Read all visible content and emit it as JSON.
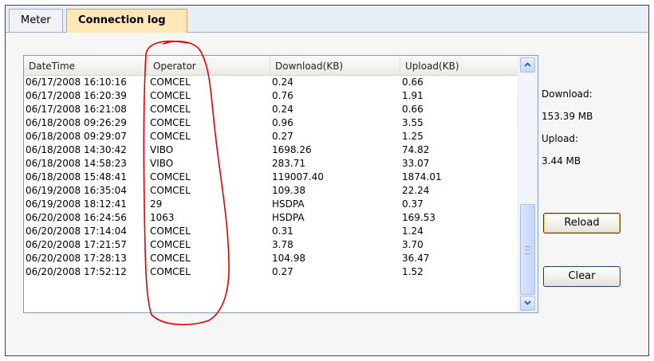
{
  "tabs": [
    {
      "label": "Meter",
      "active": false
    },
    {
      "label": "Connection log",
      "active": true
    }
  ],
  "table": {
    "columns": [
      "DateTime",
      "Operator",
      "Download(KB)",
      "Upload(KB)"
    ],
    "rows": [
      [
        "06/17/2008 16:10:16",
        "COMCEL",
        "0.24",
        "0.66"
      ],
      [
        "06/17/2008 16:20:39",
        "COMCEL",
        "0.76",
        "1.91"
      ],
      [
        "06/17/2008 16:21:08",
        "COMCEL",
        "0.24",
        "0.66"
      ],
      [
        "06/18/2008 09:26:29",
        "COMCEL",
        "0.96",
        "3.55"
      ],
      [
        "06/18/2008 09:29:07",
        "COMCEL",
        "0.27",
        "1.25"
      ],
      [
        "06/18/2008 14:30:42",
        "VIBO",
        "1698.26",
        "74.82"
      ],
      [
        "06/18/2008 14:58:23",
        "VIBO",
        "283.71",
        "33.07"
      ],
      [
        "06/18/2008 15:48:41",
        "COMCEL",
        "119007.40",
        "1874.01"
      ],
      [
        "06/19/2008 16:35:04",
        "COMCEL",
        "109.38",
        "22.24"
      ],
      [
        "06/19/2008 18:12:41",
        "29",
        "HSDPA",
        "0.37"
      ],
      [
        "06/20/2008 16:24:56",
        "1063",
        "HSDPA",
        "169.53"
      ],
      [
        "06/20/2008 17:14:04",
        "COMCEL",
        "0.31",
        "1.24"
      ],
      [
        "06/20/2008 17:21:57",
        "COMCEL",
        "3.78",
        "3.70"
      ],
      [
        "06/20/2008 17:28:13",
        "COMCEL",
        "104.98",
        "36.47"
      ],
      [
        "06/20/2008 17:52:12",
        "COMCEL",
        "0.27",
        "1.52"
      ]
    ]
  },
  "summary": {
    "download_label": "Download:",
    "download_value": "153.39 MB",
    "upload_label": "Upload:",
    "upload_value": "3.44 MB"
  },
  "buttons": {
    "reload": "Reload",
    "clear": "Clear"
  },
  "icons": {
    "scroll_up": "chevron-up-icon",
    "scroll_down": "chevron-down-icon"
  },
  "colors": {
    "active_tab": "#ffe7b8",
    "annotation": "#e00000",
    "scrollbar_accent": "#3c5db8"
  }
}
